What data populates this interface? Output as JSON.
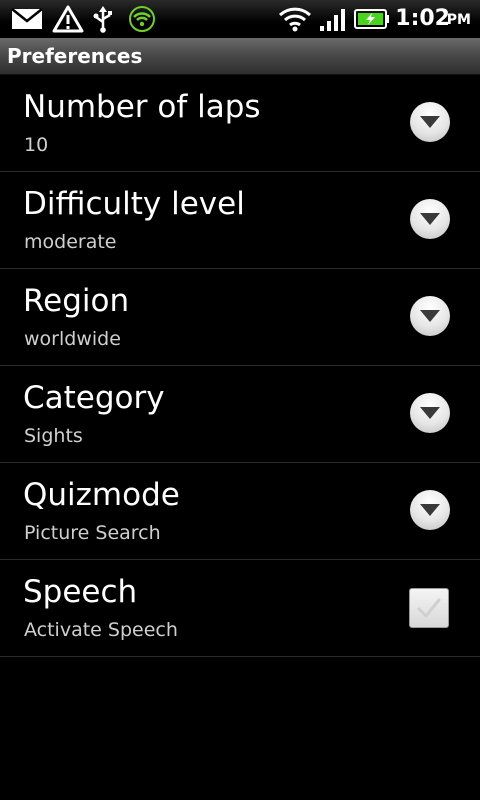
{
  "status_bar": {
    "time": "1:02",
    "ampm": "PM",
    "icons": [
      "mail-icon",
      "warning-icon",
      "usb-icon",
      "wifi-hotspot-icon",
      "wifi-icon",
      "signal-icon",
      "battery-charging-icon"
    ]
  },
  "title_bar": {
    "title": "Preferences"
  },
  "preferences": [
    {
      "title": "Number of laps",
      "summary": "10",
      "widget": "dropdown"
    },
    {
      "title": "Difficulty level",
      "summary": "moderate",
      "widget": "dropdown"
    },
    {
      "title": "Region",
      "summary": "worldwide",
      "widget": "dropdown"
    },
    {
      "title": "Category",
      "summary": "Sights",
      "widget": "dropdown"
    },
    {
      "title": "Quizmode",
      "summary": "Picture Search",
      "widget": "dropdown"
    },
    {
      "title": "Speech",
      "summary": "Activate Speech",
      "widget": "checkbox",
      "checked": false
    }
  ],
  "colors": {
    "background": "#000000",
    "summary_text": "#cfcfcf",
    "wifi_hotspot_green": "#6fcf2f",
    "battery_green": "#4ad21e"
  }
}
